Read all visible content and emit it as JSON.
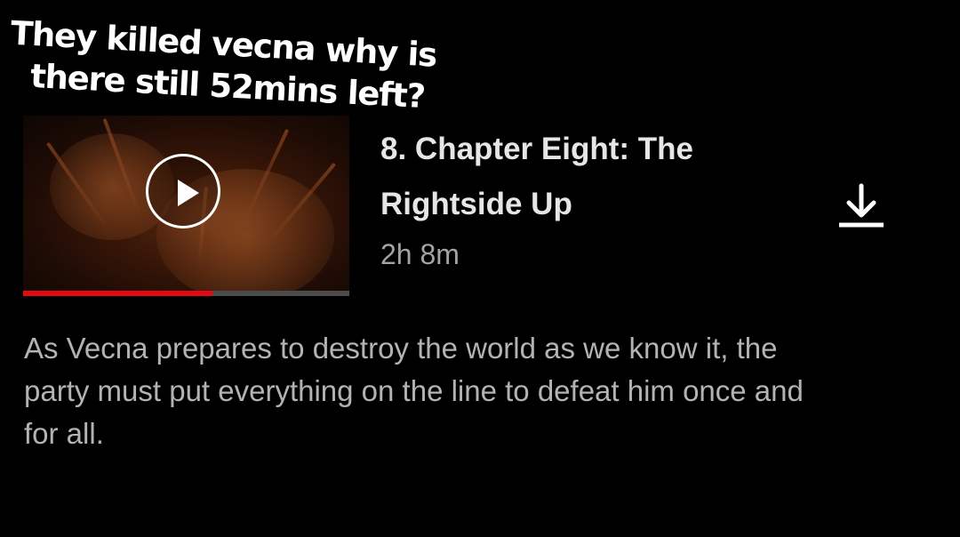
{
  "caption": {
    "line1": "They killed vecna why is",
    "line2": "there still 52mins left?"
  },
  "episode": {
    "title": "8. Chapter Eight: The Rightside Up",
    "duration": "2h 8m",
    "description": "As Vecna prepares to destroy the world as we know it, the party must put everything on the line to defeat him once and for all.",
    "progress_fraction": 0.58
  },
  "icons": {
    "play": "play-icon",
    "download": "download-icon"
  },
  "colors": {
    "background": "#000000",
    "progress": "#e50914",
    "progress_track": "#4a4a4a",
    "title": "#e6e6e6",
    "secondary_text": "#a3a3a3",
    "description_text": "#b3b3b3"
  }
}
